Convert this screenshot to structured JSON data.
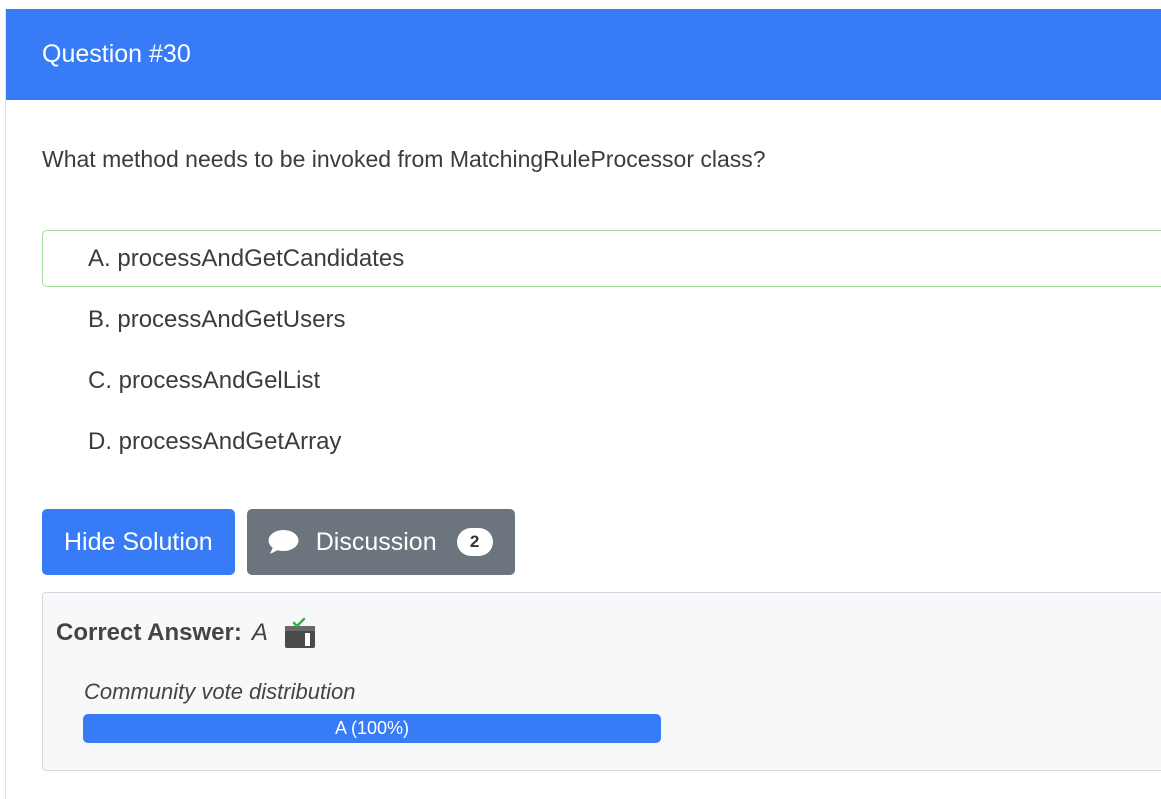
{
  "question": {
    "header": "Question #30",
    "text": "What method needs to be invoked from MatchingRuleProcessor class?",
    "choices": [
      {
        "letter": "A.",
        "text": "processAndGetCandidates",
        "correct": true
      },
      {
        "letter": "B.",
        "text": "processAndGetUsers",
        "correct": false
      },
      {
        "letter": "C.",
        "text": "processAndGelList",
        "correct": false
      },
      {
        "letter": "D.",
        "text": "processAndGetArray",
        "correct": false
      }
    ]
  },
  "buttons": {
    "hide_solution": "Hide Solution",
    "discussion": "Discussion",
    "discussion_count": "2",
    "discussion_icon": "comment-icon"
  },
  "answer": {
    "label": "Correct Answer:",
    "value": "A",
    "icon": "answer-reveal-icon"
  },
  "vote": {
    "title": "Community vote distribution",
    "bar_label": "A (100%)",
    "percent": 100
  },
  "colors": {
    "primary": "#377bf6",
    "secondary": "#6c757d",
    "correct_border": "#a4dca0"
  }
}
